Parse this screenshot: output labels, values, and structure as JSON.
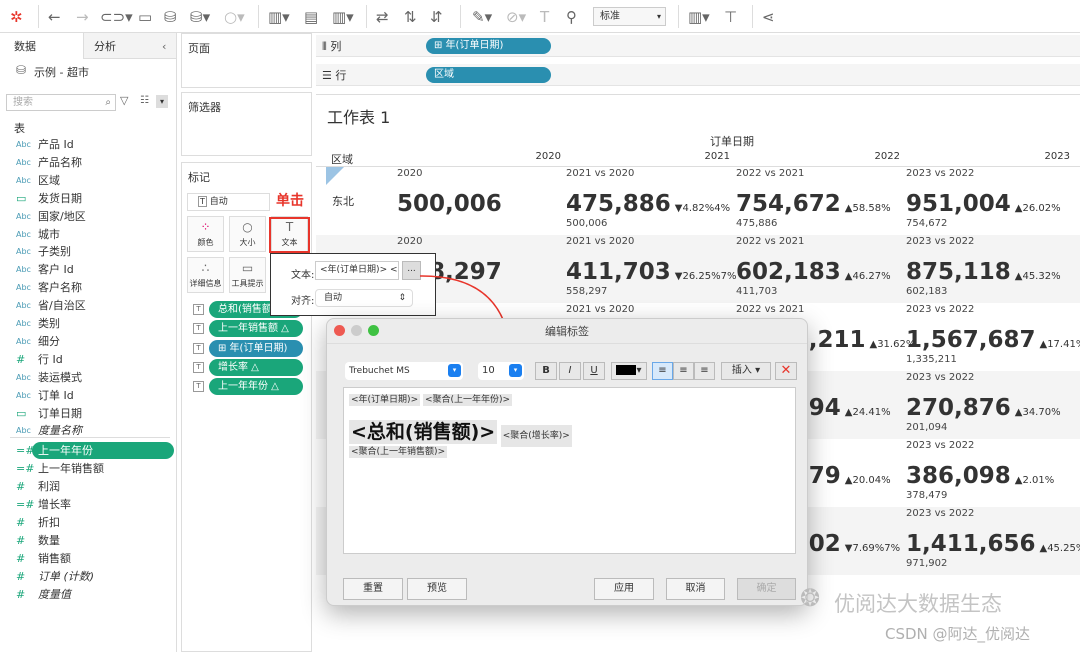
{
  "toolbar": {
    "style_select": "标准",
    "icons": [
      "tableau-logo-icon",
      "back-icon",
      "forward-icon",
      "redo-icon",
      "save-icon",
      "new-datasource-icon",
      "pause-update-icon",
      "refresh-icon",
      "new-worksheet-icon",
      "duplicate-sheet-icon",
      "clear-sheet-icon",
      "swap-icon",
      "sort-asc-icon",
      "sort-desc-icon",
      "highlight-icon",
      "group-icon",
      "label-icon",
      "pin-icon",
      "show-me-icon",
      "presentation-icon",
      "share-icon"
    ]
  },
  "left": {
    "tab_data": "数据",
    "tab_analysis": "分析",
    "datasource": "示例 - 超市",
    "search_placeholder": "搜索",
    "section": "表",
    "dimensions": [
      {
        "t": "Abc",
        "n": "产品 Id"
      },
      {
        "t": "Abc",
        "n": "产品名称"
      },
      {
        "t": "Abc",
        "n": "区域"
      },
      {
        "t": "date",
        "n": "发货日期"
      },
      {
        "t": "Abc",
        "n": "国家/地区"
      },
      {
        "t": "Abc",
        "n": "城市"
      },
      {
        "t": "Abc",
        "n": "子类别"
      },
      {
        "t": "Abc",
        "n": "客户 Id"
      },
      {
        "t": "Abc",
        "n": "客户名称"
      },
      {
        "t": "Abc",
        "n": "省/自治区"
      },
      {
        "t": "Abc",
        "n": "类别"
      },
      {
        "t": "Abc",
        "n": "细分"
      },
      {
        "t": "#",
        "n": "行 Id"
      },
      {
        "t": "Abc",
        "n": "装运模式"
      },
      {
        "t": "Abc",
        "n": "订单 Id"
      },
      {
        "t": "date",
        "n": "订单日期"
      },
      {
        "t": "Abc",
        "n": "度量名称"
      }
    ],
    "measures": [
      {
        "t": "=#",
        "n": "上一年年份",
        "selected": true
      },
      {
        "t": "=#",
        "n": "上一年销售额"
      },
      {
        "t": "#",
        "n": "利润"
      },
      {
        "t": "=#",
        "n": "增长率"
      },
      {
        "t": "#",
        "n": "折扣"
      },
      {
        "t": "#",
        "n": "数量"
      },
      {
        "t": "#",
        "n": "销售额"
      },
      {
        "t": "#",
        "n": "订单 (计数)"
      },
      {
        "t": "#",
        "n": "度量值"
      }
    ]
  },
  "cards": {
    "pages": "页面",
    "filters": "筛选器",
    "marks": "标记",
    "mark_type": "自动",
    "buttons": [
      "颜色",
      "大小",
      "文本",
      "详细信息",
      "工具提示"
    ],
    "pills": [
      {
        "label": "总和(销售额)",
        "color": "#1aa67a"
      },
      {
        "label": "上一年销售额 △",
        "color": "#1aa67a"
      },
      {
        "label": "⊞ 年(订单日期)",
        "color": "#2a8fb0"
      },
      {
        "label": "增长率            △",
        "color": "#1aa67a"
      },
      {
        "label": "上一年年份      △",
        "color": "#1aa67a"
      }
    ]
  },
  "annotation": {
    "click": "单击",
    "color": "#e8352b"
  },
  "shelves": {
    "columns_label": "列",
    "columns_pill": "⊞ 年(订单日期)",
    "rows_label": "行",
    "rows_pill": "区域"
  },
  "sheet": {
    "title": "工作表 1",
    "col_header": "订单日期",
    "row_header": "区域",
    "years": [
      "2020",
      "2021",
      "2022",
      "2023"
    ],
    "rows": [
      {
        "region": "东北",
        "cells": [
          {
            "lb": "2020",
            "big": "500,006",
            "pct": "",
            "sm": ""
          },
          {
            "lb": "2021 vs 2020",
            "big": "475,886",
            "pct": "▼4.82%4%",
            "sm": "500,006"
          },
          {
            "lb": "2022 vs 2021",
            "big": "754,672",
            "pct": "▲58.58%",
            "sm": "475,886"
          },
          {
            "lb": "2023 vs 2022",
            "big": "951,004",
            "pct": "▲26.02%",
            "sm": "754,672"
          }
        ]
      },
      {
        "region": "",
        "cells": [
          {
            "lb": "2020",
            "big": "558,297",
            "pct": "",
            "sm": ""
          },
          {
            "lb": "2021 vs 2020",
            "big": "411,703",
            "pct": "▼26.25%7%",
            "sm": "558,297"
          },
          {
            "lb": "2022 vs 2021",
            "big": "602,183",
            "pct": "▲46.27%",
            "sm": "411,703"
          },
          {
            "lb": "2023 vs 2022",
            "big": "875,118",
            "pct": "▲45.32%",
            "sm": "602,183"
          }
        ]
      },
      {
        "region": "",
        "cells": [
          {
            "lb": "",
            "big": "",
            "pct": "",
            "sm": ""
          },
          {
            "lb": "2021 vs 2020",
            "big": "",
            "pct": "",
            "sm": ""
          },
          {
            "lb": "2022 vs 2021",
            "big": "1,335,211",
            "pct": "▲31.62%",
            "sm": ""
          },
          {
            "lb": "2023 vs 2022",
            "big": "1,567,687",
            "pct": "▲17.41%",
            "sm": "1,335,211"
          }
        ]
      },
      {
        "region": "",
        "cells": [
          {
            "lb": "",
            "big": "",
            "pct": "",
            "sm": ""
          },
          {
            "lb": "",
            "big": "",
            "pct": "",
            "sm": ""
          },
          {
            "lb": "",
            "big": "201,094",
            "pct": "▲24.41%",
            "sm": ""
          },
          {
            "lb": "2023 vs 2022",
            "big": "270,876",
            "pct": "▲34.70%",
            "sm": "201,094"
          }
        ]
      },
      {
        "region": "",
        "cells": [
          {
            "lb": "",
            "big": "",
            "pct": "",
            "sm": ""
          },
          {
            "lb": "",
            "big": "",
            "pct": "",
            "sm": ""
          },
          {
            "lb": "",
            "big": "378,479",
            "pct": "▲20.04%",
            "sm": ""
          },
          {
            "lb": "2023 vs 2022",
            "big": "386,098",
            "pct": "▲2.01%",
            "sm": "378,479"
          }
        ]
      },
      {
        "region": "",
        "cells": [
          {
            "lb": "",
            "big": "",
            "pct": "",
            "sm": ""
          },
          {
            "lb": "",
            "big": "",
            "pct": "",
            "sm": ""
          },
          {
            "lb": "",
            "big": "971,902",
            "pct": "▼7.69%7%",
            "sm": ""
          },
          {
            "lb": "2023 vs 2022",
            "big": "1,411,656",
            "pct": "▲45.25%",
            "sm": "971,902"
          }
        ]
      }
    ]
  },
  "popover": {
    "text_label": "文本:",
    "text_value": "<年(订单日期)> <",
    "more": "...",
    "align_label": "对齐:",
    "align_value": "自动"
  },
  "dialog": {
    "title": "编辑标签",
    "font": "Trebuchet MS",
    "size": "10",
    "bold": "B",
    "italic": "I",
    "underline": "U",
    "insert": "插入 ▾",
    "line1": [
      "<年(订单日期)>",
      "<聚合(上一年年份)>"
    ],
    "big": "<总和(销售额)>",
    "growth": "<聚合(增长率)>",
    "line3": "<聚合(上一年销售额)>",
    "reset": "重置",
    "preview": "预览",
    "apply": "应用",
    "cancel": "取消",
    "ok": "确定"
  },
  "watermark": {
    "brand": "优阅达大数据生态",
    "csdn": "CSDN @阿达_优阅达"
  }
}
